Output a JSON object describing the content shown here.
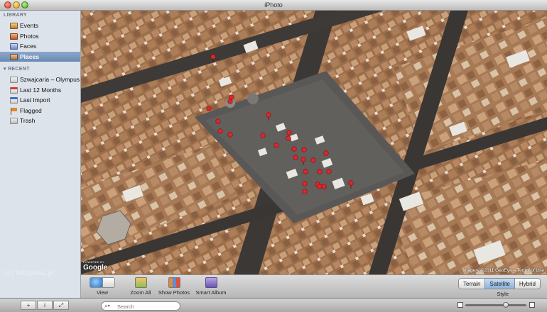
{
  "window": {
    "title": "iPhoto"
  },
  "sidebar": {
    "library_header": "LIBRARY",
    "library_items": [
      {
        "label": "Events",
        "icon": "events-icon"
      },
      {
        "label": "Photos",
        "icon": "photos-icon"
      },
      {
        "label": "Faces",
        "icon": "faces-icon"
      },
      {
        "label": "Places",
        "icon": "places-icon",
        "selected": true
      }
    ],
    "recent_header": "RECENT",
    "recent_items": [
      {
        "label": "Szwajcaria – Olympus",
        "icon": "album-icon"
      },
      {
        "label": "Last 12 Months",
        "icon": "calendar-icon"
      },
      {
        "label": "Last Import",
        "icon": "import-icon"
      },
      {
        "label": "Flagged",
        "icon": "flag-icon"
      },
      {
        "label": "Trash",
        "icon": "trash-icon"
      }
    ]
  },
  "map": {
    "google_label": "Google",
    "powered_by": "POWERED BY",
    "copyright": "Imagery ©2011 GeoEye – Terms of Use"
  },
  "toolbar": {
    "view_label": "View",
    "zoom_all_label": "Zoom All",
    "show_photos_label": "Show Photos",
    "smart_album_label": "Smart Album",
    "style_label": "Style",
    "style_options": [
      "Terrain",
      "Satellite",
      "Hybrid"
    ],
    "style_selected": "Satellite"
  },
  "bottombar": {
    "add_label": "+",
    "info_label": "i",
    "fullscreen_label": "⤢",
    "search_placeholder": "Search",
    "zoom_level": 0.68
  },
  "watermark": "fotopolis.pl",
  "colors": {
    "pin": "#e0262b",
    "selection": "#6b8bb6",
    "style_active": "#8cb3dc"
  }
}
